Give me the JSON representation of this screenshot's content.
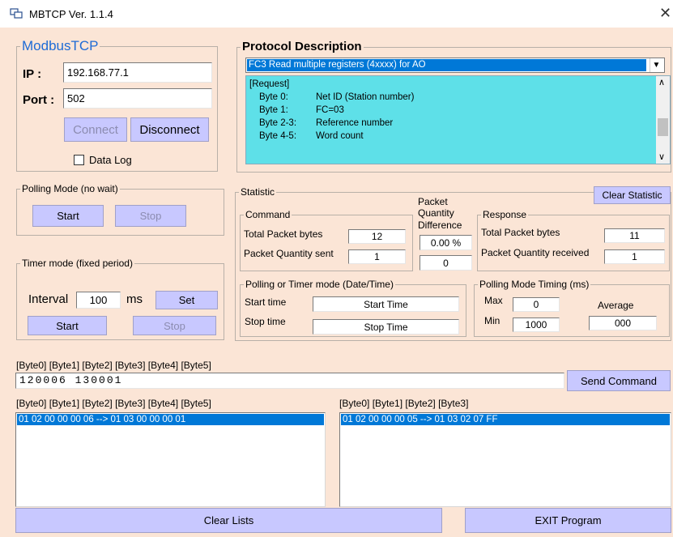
{
  "window": {
    "title": "MBTCP Ver. 1.1.4"
  },
  "modbus": {
    "legend": "ModbusTCP",
    "ip_label": "IP :",
    "ip_value": "192.168.77.1",
    "port_label": "Port :",
    "port_value": "502",
    "connect_label": "Connect",
    "disconnect_label": "Disconnect",
    "datalog_label": "Data Log"
  },
  "protocol": {
    "legend": "Protocol Description",
    "selected": "FC3  Read multiple registers (4xxxx)  for AO",
    "lines": [
      {
        "key": "[Request]",
        "val": ""
      },
      {
        "key": "Byte 0:",
        "val": "Net ID (Station number)"
      },
      {
        "key": "Byte 1:",
        "val": "FC=03"
      },
      {
        "key": "Byte 2-3:",
        "val": "Reference number"
      },
      {
        "key": "Byte 4-5:",
        "val": "Word count"
      }
    ]
  },
  "polling": {
    "legend": "Polling Mode (no wait)",
    "start_label": "Start",
    "stop_label": "Stop"
  },
  "timer": {
    "legend": "Timer mode (fixed period)",
    "interval_label": "Interval",
    "interval_value": "100",
    "unit": "ms",
    "set_label": "Set",
    "start_label": "Start",
    "stop_label": "Stop"
  },
  "statistic": {
    "legend": "Statistic",
    "clear_label": "Clear Statistic",
    "command": {
      "legend": "Command",
      "total_label": "Total Packet bytes",
      "total_value": "12",
      "qty_label": "Packet Quantity sent",
      "qty_value": "1"
    },
    "diff": {
      "label_line1": "Packet",
      "label_line2": "Quantity",
      "label_line3": "Difference",
      "percent": "0.00 %",
      "count": "0"
    },
    "response": {
      "legend": "Response",
      "total_label": "Total Packet bytes",
      "total_value": "11",
      "qty_label": "Packet Quantity received",
      "qty_value": "1"
    },
    "datetime": {
      "legend": "Polling  or Timer mode  (Date/Time)",
      "start_label": "Start time",
      "start_value": "Start Time",
      "stop_label": "Stop time",
      "stop_value": "Stop Time"
    },
    "timing": {
      "legend": "Polling Mode Timing (ms)",
      "max_label": "Max",
      "max_value": "0",
      "min_label": "Min",
      "min_value": "1000",
      "avg_label": "Average",
      "avg_value": "000"
    }
  },
  "command_line": {
    "header": "[Byte0]  [Byte1]  [Byte2]  [Byte3]  [Byte4]  [Byte5]",
    "value": "120006 130001",
    "send_label": "Send Command"
  },
  "sent_list": {
    "header": "[Byte0]  [Byte1]  [Byte2]  [Byte3]  [Byte4]  [Byte5]",
    "items": [
      "01 02 00 00 00 06 --> 01 03 00 00 00 01"
    ]
  },
  "recv_list": {
    "header": "[Byte0]  [Byte1]  [Byte2]  [Byte3]",
    "items": [
      "01 02 00 00 00 05 --> 01 03 02 07 FF"
    ]
  },
  "bottom": {
    "clear_lists_label": "Clear Lists",
    "exit_label": "EXIT Program"
  },
  "colors": {
    "background": "#fbe5d6",
    "button": "#c8c8ff",
    "protocol_panel": "#5ee0e8",
    "selection": "#0078d7",
    "modbus_legend": "#1e6bd6"
  }
}
